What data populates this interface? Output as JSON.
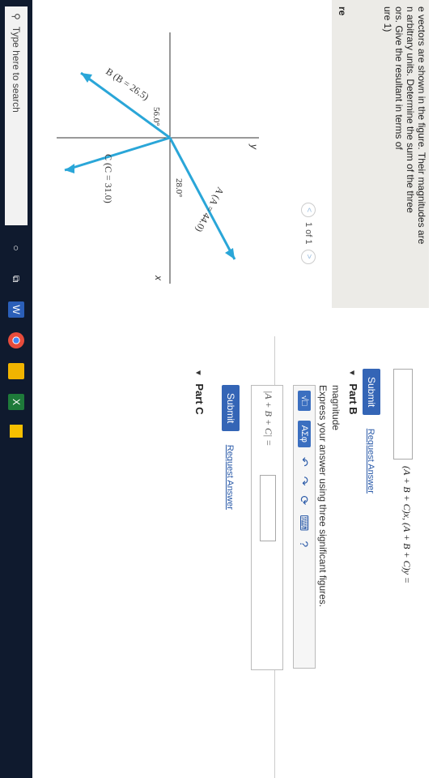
{
  "problem": {
    "text": "e vectors are shown in the figure. Their magnitudes are\nn arbitrary units. Determine the sum of the three\nors. Give the resultant in terms of\nure 1)",
    "figure_label": "re"
  },
  "pager": {
    "prev": "<",
    "text": "1 of 1",
    "next": ">"
  },
  "figure": {
    "axis_x": "x",
    "axis_y": "y",
    "vec_a": "A (A = 44.0)",
    "vec_b": "B (B = 26.5)",
    "vec_c": "C (C = 31.0)",
    "angle_b": "56.0°",
    "angle_a": "28.0°",
    "color": "#2aa6d8"
  },
  "partA": {
    "label": "(A + B + C)x, (A + B + C)y =",
    "submit": "Submit",
    "request": "Request Answer"
  },
  "partB": {
    "title": "Part B",
    "subtitle": "magnitude",
    "instruction": "Express your answer using three significant figures.",
    "tool1": "√□",
    "tool2": "ΑΣφ",
    "undo": "↶",
    "redo": "↷",
    "reset": "⟳",
    "keyboard": "⌨",
    "help": "?",
    "answer_label": "|A + B + C| =",
    "submit": "Submit",
    "request": "Request Answer"
  },
  "partC": {
    "title": "Part C"
  },
  "taskbar": {
    "search_placeholder": "Type here to search"
  }
}
